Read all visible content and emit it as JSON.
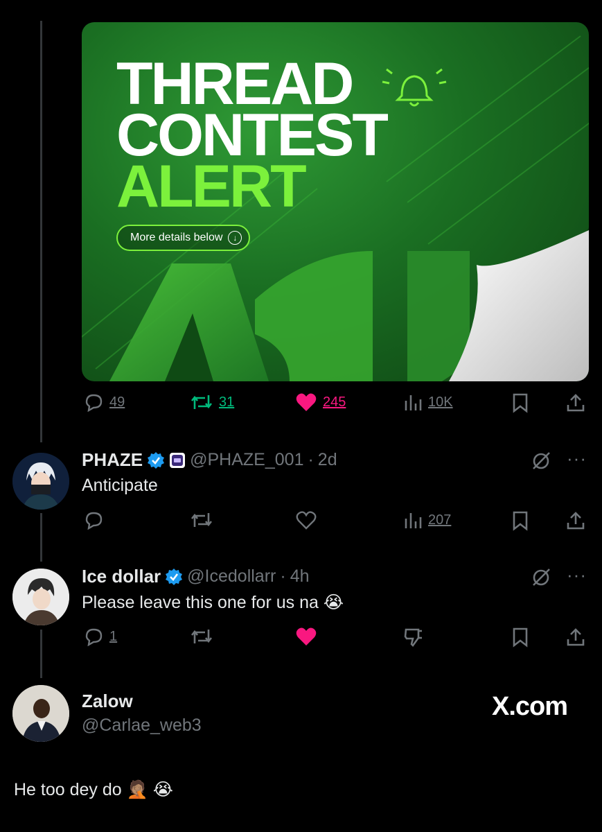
{
  "media": {
    "title_line1": "THREAD",
    "title_line2": "CONTEST",
    "title_line3": "ALERT",
    "pill_label": "More details below"
  },
  "main_actions": {
    "replies": "49",
    "reposts": "31",
    "likes": "245",
    "views": "10K",
    "repost_color": "#00ba7c",
    "like_color": "#f91880"
  },
  "replies": [
    {
      "name": "PHAZE",
      "handle": "@PHAZE_001",
      "time": "2d",
      "text": "Anticipate",
      "views": "207"
    },
    {
      "name": "Ice dollar",
      "handle": "@Icedollarr",
      "time": "4h",
      "text": "Please leave this one for us na",
      "emoji": "😭",
      "replies": "1"
    }
  ],
  "quote": {
    "name": "Zalow",
    "handle": "@Carlae_web3",
    "text": "He too dey do",
    "emoji1": "🤦🏽",
    "emoji2": "😭",
    "watermark": "X.com"
  },
  "icons": [
    "reply-icon",
    "repost-icon",
    "like-icon",
    "views-icon",
    "bookmark-icon",
    "share-icon",
    "verified-badge-icon",
    "grok-icon",
    "more-icon",
    "dislike-icon"
  ]
}
